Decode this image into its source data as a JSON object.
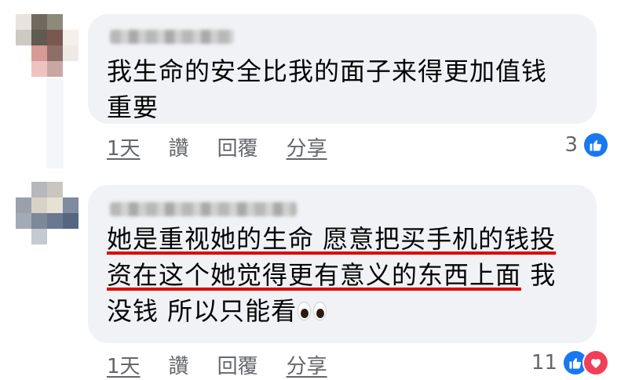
{
  "comments": [
    {
      "text_lines": [
        "我生命的安全比我的面子来得更加值钱",
        "重要"
      ],
      "actions": {
        "time": "1天",
        "like": "讚",
        "reply": "回覆",
        "share": "分享"
      },
      "reaction_count": "3",
      "reactions": [
        "like-icon"
      ]
    },
    {
      "text_lines": [
        "她是重视她的生命 愿意把买手机的钱投",
        "资在这个她觉得更有意义的东西上面",
        " 我",
        "没钱 所以只能看"
      ],
      "emoji": "eyes-emoji",
      "actions": {
        "time": "1天",
        "like": "讚",
        "reply": "回覆",
        "share": "分享"
      },
      "reaction_count": "11",
      "reactions": [
        "like-icon",
        "love-icon"
      ]
    }
  ],
  "colors": {
    "bubble": "#f0f2f5",
    "underline": "#e00000",
    "like": "#1877f2",
    "love": "#f33e58",
    "meta": "#65676b"
  }
}
